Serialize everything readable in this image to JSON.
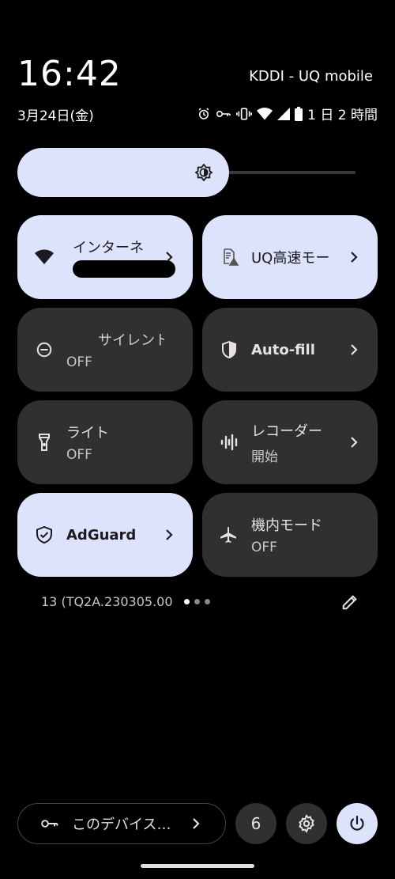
{
  "statusbar": {
    "time": "16:42",
    "carrier": "KDDI - UQ mobile",
    "date": "3月24日(金)",
    "battery_text": "1 日 2 時間"
  },
  "tiles": [
    {
      "id": "internet",
      "line1": "インターネ",
      "line2": "",
      "state": "on"
    },
    {
      "id": "uq",
      "line1": "UQ高速モー",
      "line2": "",
      "state": "on"
    },
    {
      "id": "silent",
      "line1": "サイレント",
      "line2": "OFF",
      "state": "off"
    },
    {
      "id": "autofill",
      "line1": "Auto-fill",
      "line2": "",
      "state": "off"
    },
    {
      "id": "light",
      "line1": "ライト",
      "line2": "OFF",
      "state": "off"
    },
    {
      "id": "recorder",
      "line1": "レコーダー",
      "line2": "開始",
      "state": "off"
    },
    {
      "id": "adguard",
      "line1": "AdGuard",
      "line2": "",
      "state": "on"
    },
    {
      "id": "airplane",
      "line1": "機内モード",
      "line2": "OFF",
      "state": "off"
    }
  ],
  "footer": {
    "build": "13 (TQ2A.230305.00",
    "vpn_label": "このデバイス…",
    "notification_count": "6"
  },
  "colors": {
    "tile_on": "#dde3fb",
    "tile_off": "#303030",
    "background": "#000000"
  }
}
